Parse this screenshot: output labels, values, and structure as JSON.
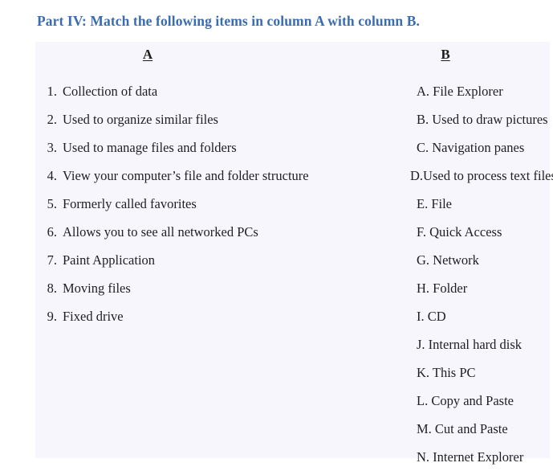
{
  "heading": {
    "text": "Part IV: Match the following items in column A with column B.",
    "color": "#3b6cb0"
  },
  "panel": {
    "background": "#f6f6fc"
  },
  "columns": {
    "a": {
      "header": "A",
      "items": [
        {
          "marker": "1.",
          "text": "Collection of data"
        },
        {
          "marker": "2.",
          "text": "Used to organize similar files"
        },
        {
          "marker": "3.",
          "text": "Used to manage files and folders"
        },
        {
          "marker": "4.",
          "text": "View your computer’s file and folder structure"
        },
        {
          "marker": "5.",
          "text": "Formerly called favorites"
        },
        {
          "marker": "6.",
          "text": "Allows you to see all networked PCs"
        },
        {
          "marker": "7.",
          "text": "Paint Application"
        },
        {
          "marker": "8.",
          "text": "Moving files"
        },
        {
          "marker": "9.",
          "text": "Fixed drive"
        }
      ]
    },
    "b": {
      "header": "B",
      "items": [
        {
          "text": "A. File Explorer"
        },
        {
          "text": "B. Used to draw pictures"
        },
        {
          "text": "C. Navigation panes"
        },
        {
          "text": "D.Used to process text files"
        },
        {
          "text": "E. File"
        },
        {
          "text": "F. Quick Access"
        },
        {
          "text": "G. Network"
        },
        {
          "text": "H. Folder"
        },
        {
          "text": "I. CD"
        },
        {
          "text": "J. Internal hard disk"
        },
        {
          "text": "K. This PC"
        },
        {
          "text": "L. Copy and Paste"
        },
        {
          "text": "M. Cut and Paste"
        },
        {
          "text": "N. Internet Explorer"
        }
      ]
    }
  }
}
